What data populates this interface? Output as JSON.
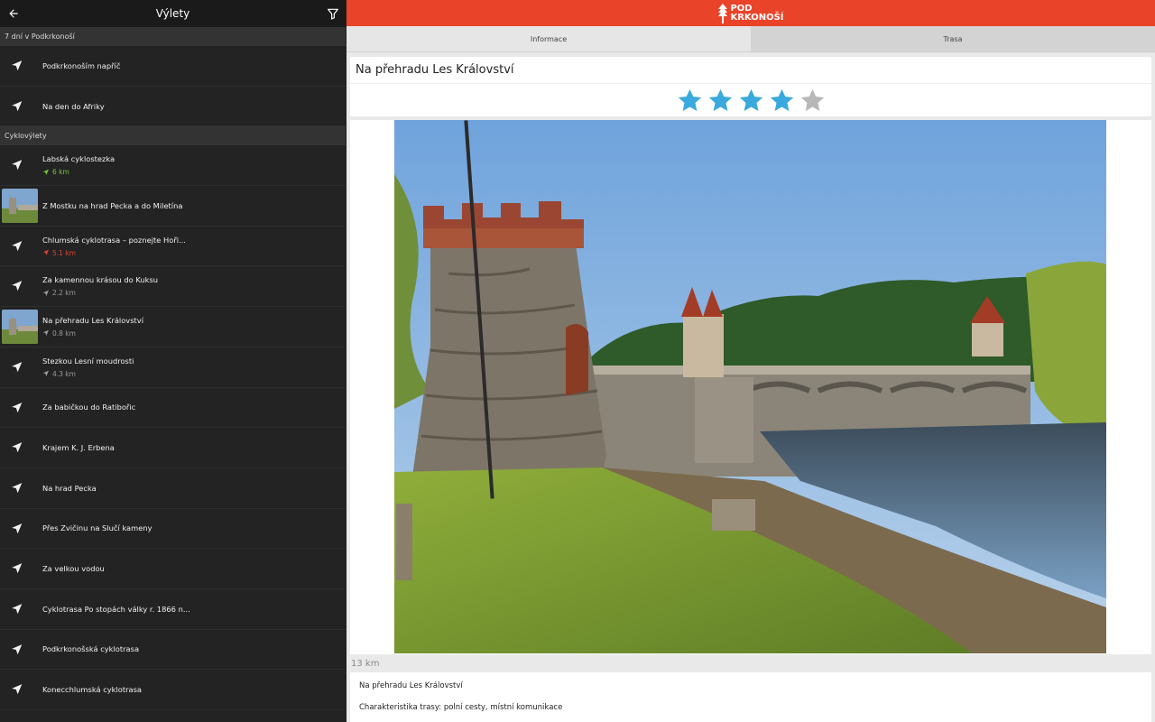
{
  "left_panel": {
    "title": "Výlety",
    "sections": [
      {
        "header": "7 dní v Podkrkonoší",
        "items": [
          {
            "name": "Podkrkonoším napříč",
            "distance": null,
            "thumb": false
          },
          {
            "name": "Na den do Afriky",
            "distance": null,
            "thumb": false
          }
        ]
      },
      {
        "header": "Cyklovýlety",
        "items": [
          {
            "name": "Labská cyklostezka",
            "distance": "6 km",
            "dist_color": "green",
            "thumb": false
          },
          {
            "name": "Z Mostku na hrad Pecka a do Miletína",
            "distance": null,
            "thumb": true
          },
          {
            "name": "Chlumská cyklotrasa – poznejte Hoři...",
            "distance": "5.1 km",
            "dist_color": "red",
            "thumb": false
          },
          {
            "name": "Za kamennou krásou do Kuksu",
            "distance": "2.2 km",
            "dist_color": "grey",
            "thumb": false
          },
          {
            "name": "Na přehradu Les Království",
            "distance": "0.8 km",
            "dist_color": "grey",
            "thumb": true
          },
          {
            "name": "Stezkou Lesní moudrosti",
            "distance": "4.3 km",
            "dist_color": "grey",
            "thumb": false
          },
          {
            "name": "Za babičkou do Ratibořic",
            "distance": null,
            "thumb": false
          },
          {
            "name": "Krajem K. J. Erbena",
            "distance": null,
            "thumb": false
          },
          {
            "name": "Na hrad Pecka",
            "distance": null,
            "thumb": false
          },
          {
            "name": "Přes Zvičinu na Slučí kameny",
            "distance": null,
            "thumb": false
          },
          {
            "name": "Za velkou vodou",
            "distance": null,
            "thumb": false
          },
          {
            "name": "Cyklotrasa Po stopách války r. 1866 n...",
            "distance": null,
            "thumb": false
          },
          {
            "name": "Podkrkonošská cyklotrasa",
            "distance": null,
            "thumb": false
          },
          {
            "name": "Konecchlumská cyklotrasa",
            "distance": null,
            "thumb": false
          }
        ]
      }
    ]
  },
  "right_panel": {
    "logo_line1": "POD",
    "logo_line2": "KRKONOŠÍ",
    "tabs": [
      "Informace",
      "Trasa"
    ],
    "active_tab": 0,
    "trip_title": "Na přehradu Les Království",
    "rating": 4,
    "rating_max": 5,
    "distance": "13 km",
    "description_title": "Na přehradu Les Království",
    "description_text": "Charakteristika trasy: polní cesty, místní komunikace"
  },
  "colors": {
    "brand": "#e9442a",
    "star_on": "#3aa9dd",
    "star_off": "#b8b8b8",
    "dist_green": "#7cc13a",
    "dist_red": "#d9453a"
  },
  "icons": {
    "back": "arrow-left-icon",
    "filter": "filter-funnel-icon",
    "nav": "navigation-arrow-icon",
    "star": "star-icon"
  }
}
